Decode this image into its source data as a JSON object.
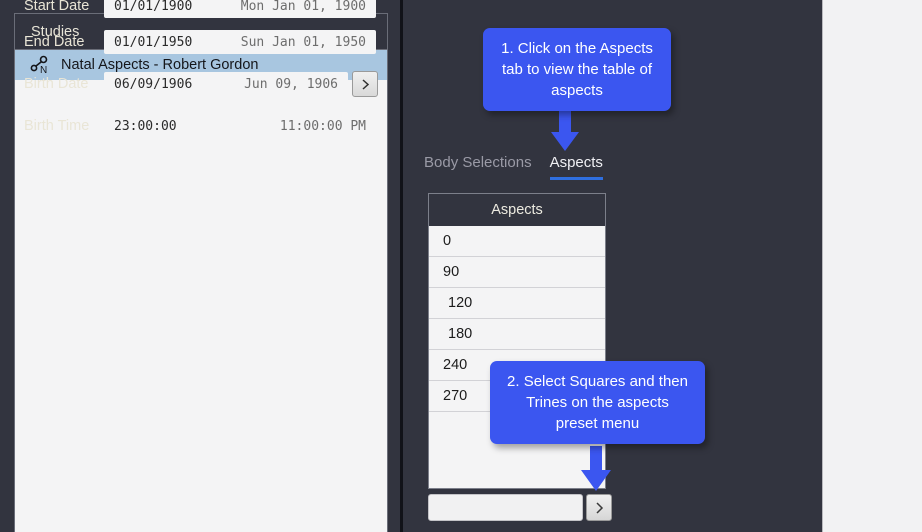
{
  "sidebar": {
    "header": "Studies",
    "items": [
      {
        "icon": "natal-chart-icon",
        "label": "Natal Aspects - Robert Gordon",
        "selected": true
      }
    ]
  },
  "form": {
    "fields": [
      {
        "label": "Start Date",
        "value": "01/01/1900",
        "formatted": "Mon Jan 01, 1900",
        "stepper": false
      },
      {
        "label": "End Date",
        "value": "01/01/1950",
        "formatted": "Sun Jan 01, 1950",
        "stepper": false
      },
      {
        "label": "Birth Date",
        "value": "06/09/1906",
        "formatted": "Jun 09, 1906",
        "stepper": true
      },
      {
        "label": "Birth Time",
        "value": "23:00:00",
        "formatted": "11:00:00 PM",
        "stepper": false
      }
    ]
  },
  "tabs": [
    {
      "label": "Body Selections",
      "active": false
    },
    {
      "label": "Aspects",
      "active": true
    }
  ],
  "aspects_table": {
    "header": "Aspects",
    "rows": [
      "0",
      "90",
      "120",
      "180",
      "240",
      "270"
    ]
  },
  "preset": {
    "value": "",
    "placeholder": "",
    "next_icon": "chevron-right-icon"
  },
  "callouts": [
    {
      "text": "1. Click on the Aspects tab to view the table of aspects"
    },
    {
      "text": "2. Select Squares and then Trines on the aspects preset menu"
    }
  ],
  "colors": {
    "panel_dark": "#32343f",
    "callout_blue": "#3b56f0",
    "tab_accent": "#2f6fe0",
    "selection_blue": "#a8c6e0",
    "label_cream": "#e9e5d6"
  }
}
